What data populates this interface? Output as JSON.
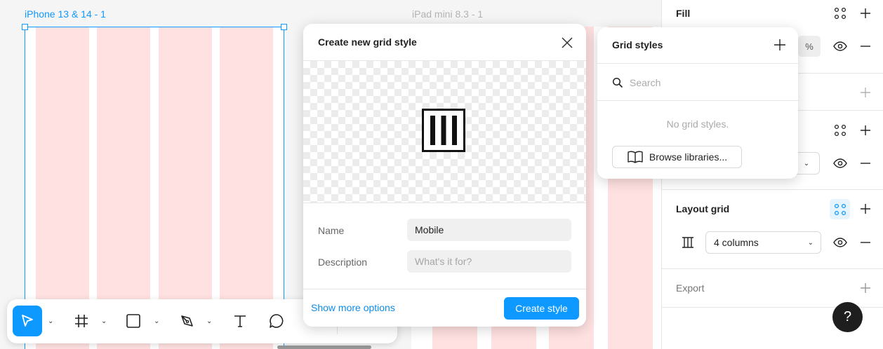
{
  "canvas": {
    "frame_iphone_label": "iPhone 13 & 14 - 1",
    "frame_ipad_label": "iPad mini 8.3 - 1",
    "accent_color": "#0d99ff",
    "grid_color": "#ffe1e1"
  },
  "toolbar": {
    "tools": [
      {
        "name": "move-tool",
        "icon": "cursor-icon",
        "active": true
      },
      {
        "name": "frame-tool",
        "icon": "hash-icon"
      },
      {
        "name": "shape-tool",
        "icon": "rectangle-icon"
      },
      {
        "name": "pen-tool",
        "icon": "pen-icon"
      },
      {
        "name": "text-tool",
        "icon": "text-icon",
        "glyph": "T"
      },
      {
        "name": "comment-tool",
        "icon": "comment-icon"
      }
    ]
  },
  "create_dialog": {
    "title": "Create new grid style",
    "name_label": "Name",
    "name_value": "Mobile",
    "description_label": "Description",
    "description_placeholder": "What's it for?",
    "show_more_label": "Show more options",
    "create_label": "Create style"
  },
  "grid_styles_popover": {
    "title": "Grid styles",
    "search_placeholder": "Search",
    "empty_text": "No grid styles.",
    "browse_label": "Browse libraries..."
  },
  "right_panel": {
    "fill_title": "Fill",
    "fill_percent_symbol": "%",
    "layout_grid_title": "Layout grid",
    "layout_grid_value": "4 columns",
    "export_title": "Export",
    "help_label": "?"
  }
}
